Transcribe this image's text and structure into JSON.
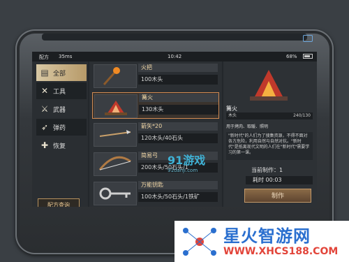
{
  "status": {
    "carrier": "配方",
    "signal": "35ms",
    "time": "10:42",
    "battery": "68%"
  },
  "sidebar": {
    "items": [
      {
        "label": "全部",
        "icon": "chest-icon"
      },
      {
        "label": "工具",
        "icon": "tools-icon"
      },
      {
        "label": "武器",
        "icon": "weapons-icon"
      },
      {
        "label": "弹药",
        "icon": "ammo-icon"
      },
      {
        "label": "恢复",
        "icon": "bandage-icon"
      }
    ],
    "recipe_button": "配方查询"
  },
  "items": [
    {
      "name": "火把",
      "cost": "100木头"
    },
    {
      "name": "篝火",
      "cost": "130木头"
    },
    {
      "name": "箭矢*20",
      "cost": "120木头/40石头"
    },
    {
      "name": "简易弓",
      "cost": "200木头/50石头/1"
    },
    {
      "name": "万能钥匙",
      "cost": "100木头/50石头/1铁矿"
    }
  ],
  "detail": {
    "title": "篝火",
    "resource": "木头",
    "resource_count": "240/130",
    "use": "用于烤肉、取暖、照明",
    "desc": "\"新时代\"的人们为了搜集资源，不得不面对各方危险，利用自然与自然对抗。\"新时代\"是抵离现代文明的人们在\"新时代\"需要学习的第一课。",
    "making_now": "当前制作：1",
    "time_label": "耗时",
    "time_value": "00:03",
    "make_button": "制作"
  },
  "watermark": {
    "site": "91游戏",
    "site_url": "91danji.com",
    "brand": "星火智游网",
    "brand_url": "WWW.XHCS188.COM"
  },
  "colors": {
    "accent": "#d08a52",
    "active_tab": "#c9b58c"
  }
}
